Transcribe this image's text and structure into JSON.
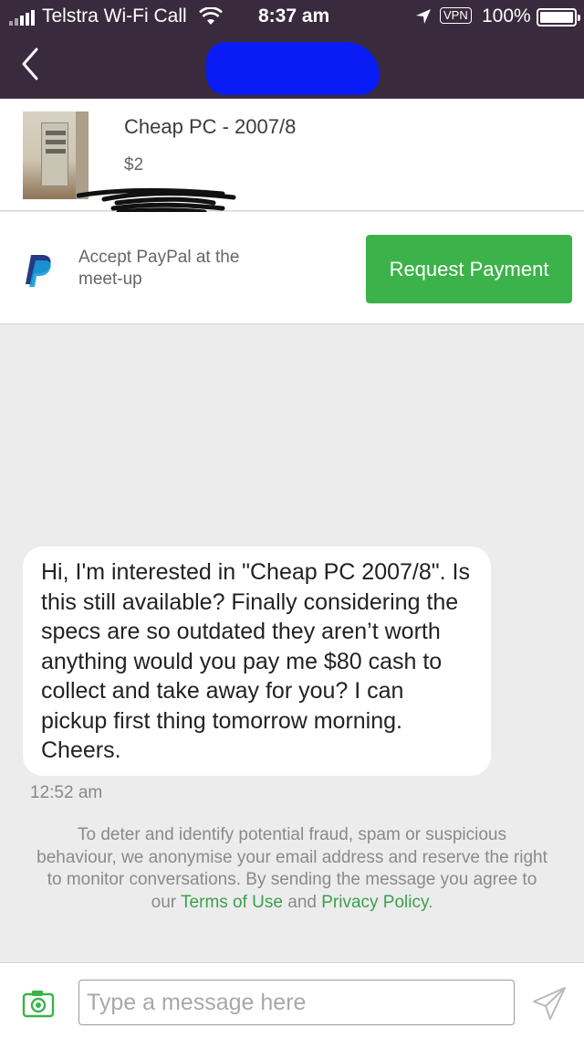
{
  "status_bar": {
    "carrier": "Telstra Wi-Fi Call",
    "time": "8:37 am",
    "vpn": "VPN",
    "battery": "100%"
  },
  "nav": {
    "back_icon": "chevron-left-icon"
  },
  "listing": {
    "title": "Cheap PC - 2007/8",
    "price": "$2"
  },
  "paypal": {
    "text": "Accept PayPal at the meet-up",
    "button_label": "Request Payment"
  },
  "conversation": {
    "messages": [
      {
        "text": "Hi, I'm interested in \"Cheap PC 2007/8\". Is this still available? Finally considering the specs are so outdated they aren’t worth anything would you pay me $80 cash to collect and take away for you? I can pickup first thing tomorrow morning. Cheers.",
        "time": "12:52 am"
      }
    ],
    "notice": {
      "text": "To deter and identify potential fraud, spam or suspicious behaviour, we anonymise your email address and reserve the right to monitor conversations. By sending the message you agree to our",
      "terms_link": "Terms of Use",
      "and": "and",
      "privacy_link": "Privacy Policy",
      "end": "."
    }
  },
  "composer": {
    "placeholder": "Type a message here",
    "camera_icon": "camera-icon",
    "send_icon": "send-icon"
  },
  "colors": {
    "header": "#3a2a3d",
    "accent_green": "#3cb34a",
    "background": "#ececec"
  }
}
